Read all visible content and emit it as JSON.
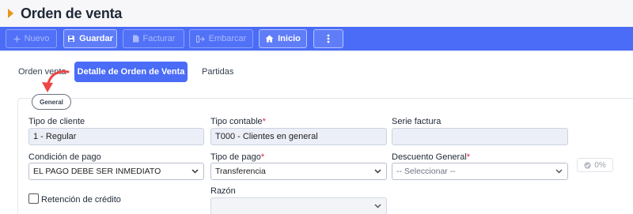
{
  "page": {
    "title": "Orden de venta"
  },
  "toolbar": {
    "nuevo": "Nuevo",
    "guardar": "Guardar",
    "facturar": "Facturar",
    "embarcar": "Embarcar",
    "inicio": "Inicio"
  },
  "tabs": {
    "orden": "Orden venta",
    "detalle": "Detalle de Orden de Venta",
    "partidas": "Partidas"
  },
  "section": {
    "label": "General"
  },
  "form": {
    "tipo_cliente": {
      "label": "Tipo de cliente",
      "value": "1 - Regular"
    },
    "tipo_contable": {
      "label": "Tipo contable",
      "required": "*",
      "value": "T000 - Clientes en general"
    },
    "serie_factura": {
      "label": "Serie factura",
      "value": ""
    },
    "condicion_pago": {
      "label": "Condición de pago",
      "value": "EL PAGO DEBE SER INMEDIATO"
    },
    "tipo_pago": {
      "label": "Tipo de pago",
      "required": "*",
      "value": "Transferencia"
    },
    "descuento_general": {
      "label": "Descuento General",
      "required": "*",
      "value": "-- Seleccionar --"
    },
    "descuento_badge": "0%",
    "retencion": {
      "label": "Retención de crédito"
    },
    "razon": {
      "label": "Razón",
      "value": ""
    }
  },
  "colors": {
    "accent": "#4a6cf7",
    "title_marker": "#e8951a",
    "required": "#e11d48",
    "arrow": "#ef4444"
  },
  "icons": [
    "caret-right-icon",
    "plus-icon",
    "save-icon",
    "invoice-icon",
    "ship-icon",
    "home-icon",
    "more-vertical-icon",
    "chevron-down-icon",
    "check-circle-icon",
    "arrow-icon"
  ]
}
